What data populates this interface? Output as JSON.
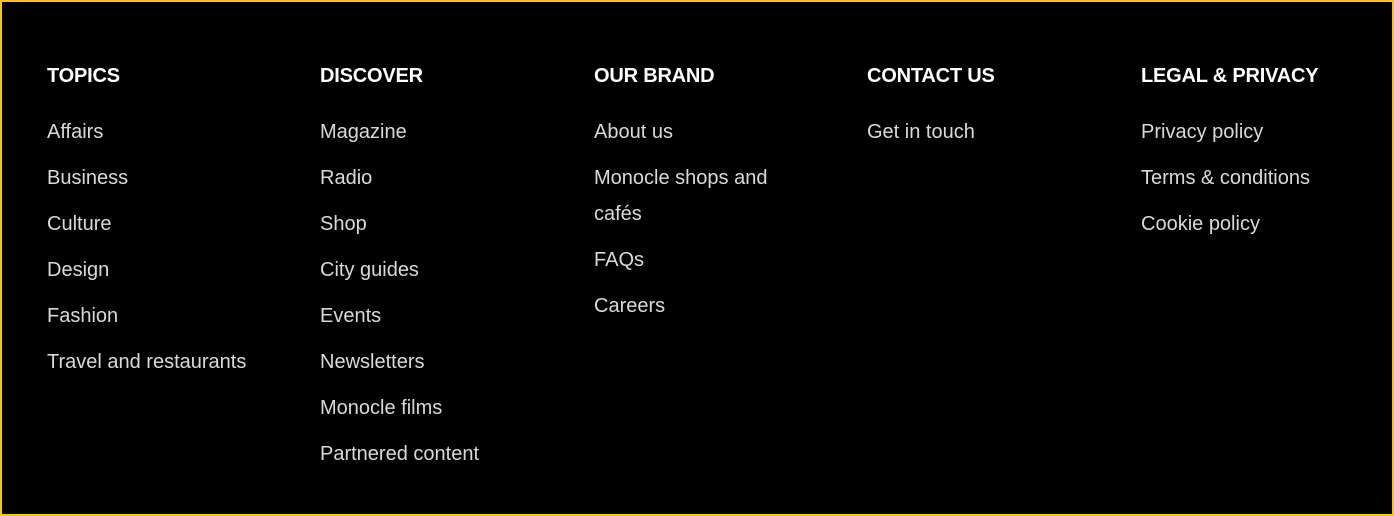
{
  "footer": {
    "colors": {
      "background": "#000000",
      "border": "#f5c518",
      "heading": "#ffffff",
      "link": "#d9d9d9"
    },
    "columns": [
      {
        "heading": "TOPICS",
        "links": [
          "Affairs",
          "Business",
          "Culture",
          "Design",
          "Fashion",
          "Travel and restaurants"
        ]
      },
      {
        "heading": "DISCOVER",
        "links": [
          "Magazine",
          "Radio",
          "Shop",
          "City guides",
          "Events",
          "Newsletters",
          "Monocle films",
          "Partnered content"
        ]
      },
      {
        "heading": "OUR BRAND",
        "links": [
          "About us",
          "Monocle shops and cafés",
          "FAQs",
          "Careers"
        ]
      },
      {
        "heading": "CONTACT US",
        "links": [
          "Get in touch"
        ]
      },
      {
        "heading": "LEGAL & PRIVACY",
        "links": [
          "Privacy policy",
          "Terms & conditions",
          "Cookie policy"
        ]
      }
    ]
  }
}
